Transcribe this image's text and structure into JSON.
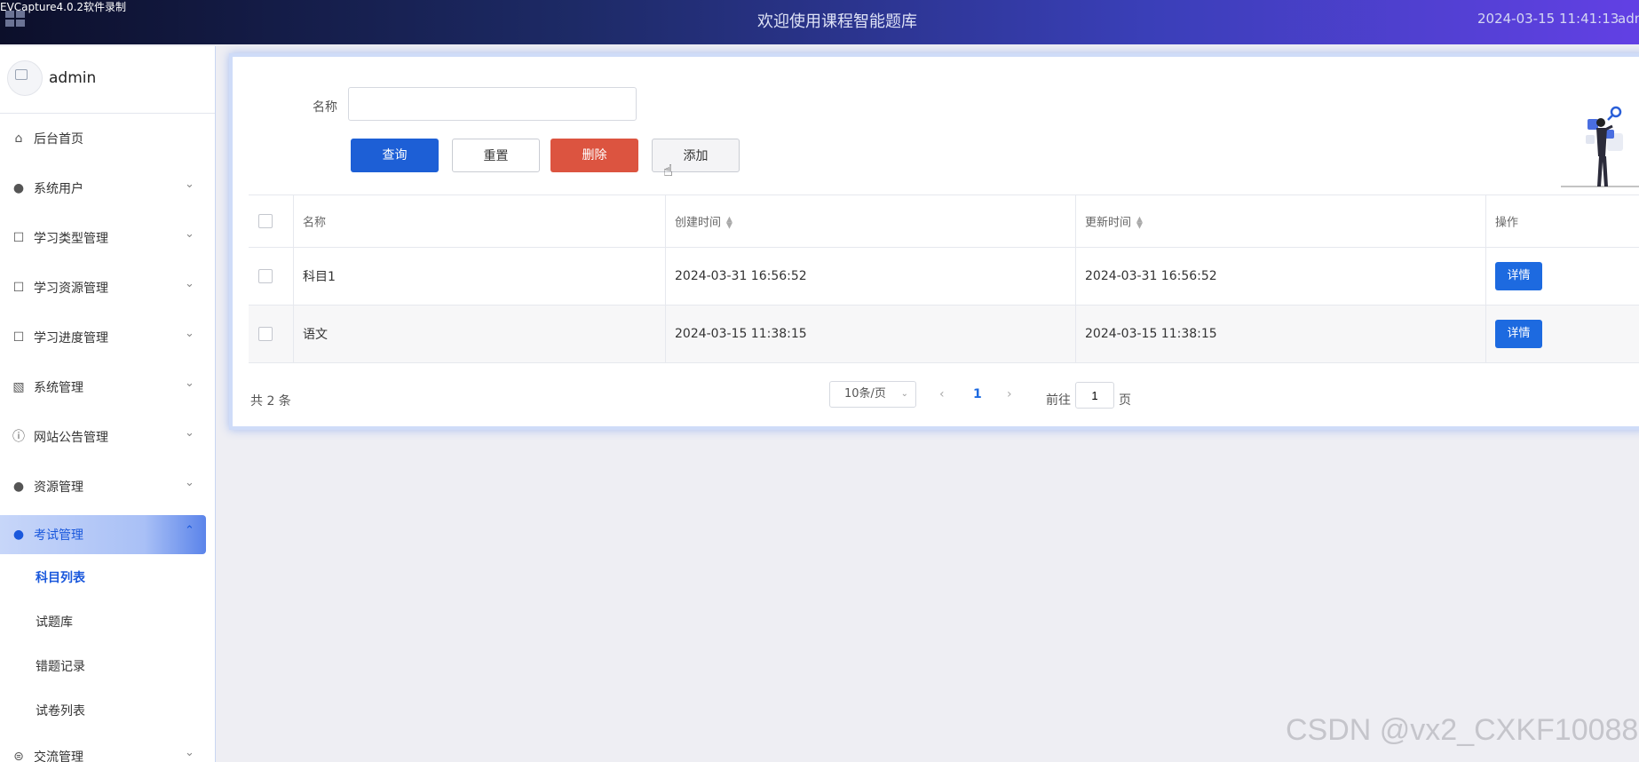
{
  "header": {
    "recorder_label": "EVCapture4.0.2软件录制",
    "title": "欢迎使用课程智能题库",
    "datetime": "2024-03-15 11:41:13",
    "user": "admin"
  },
  "sidebar": {
    "username": "admin",
    "items": [
      {
        "label": "后台首页",
        "icon": "home-icon"
      },
      {
        "label": "系统用户",
        "icon": "user-icon"
      },
      {
        "label": "学习类型管理",
        "icon": "tag-icon"
      },
      {
        "label": "学习资源管理",
        "icon": "tag-icon"
      },
      {
        "label": "学习进度管理",
        "icon": "tag-icon"
      },
      {
        "label": "系统管理",
        "icon": "image-icon"
      },
      {
        "label": "网站公告管理",
        "icon": "info-icon"
      },
      {
        "label": "资源管理",
        "icon": "bulb-icon"
      },
      {
        "label": "考试管理",
        "icon": "bulb-icon"
      }
    ],
    "subitems": [
      "科目列表",
      "试题库",
      "错题记录",
      "试卷列表"
    ],
    "last_item": "交流管理"
  },
  "search": {
    "label": "名称",
    "value": "",
    "placeholder": ""
  },
  "toolbar": {
    "query": "查询",
    "reset": "重置",
    "delete": "删除",
    "add": "添加"
  },
  "table": {
    "headers": {
      "name": "名称",
      "created": "创建时间",
      "updated": "更新时间",
      "ops": "操作"
    },
    "rows": [
      {
        "name": "科目1",
        "created": "2024-03-31 16:56:52",
        "updated": "2024-03-31 16:56:52",
        "action": "详情"
      },
      {
        "name": "语文",
        "created": "2024-03-15 11:38:15",
        "updated": "2024-03-15 11:38:15",
        "action": "详情"
      }
    ]
  },
  "pagination": {
    "total": "共 2 条",
    "page_size": "10条/页",
    "current": "1",
    "goto_pre": "前往",
    "goto_value": "1",
    "goto_post": "页"
  },
  "watermark": "CSDN @vx2_CXKF10088",
  "colors": {
    "primary": "#1d5fd6",
    "danger": "#dc5440",
    "active_menu": "#1a58dc"
  }
}
